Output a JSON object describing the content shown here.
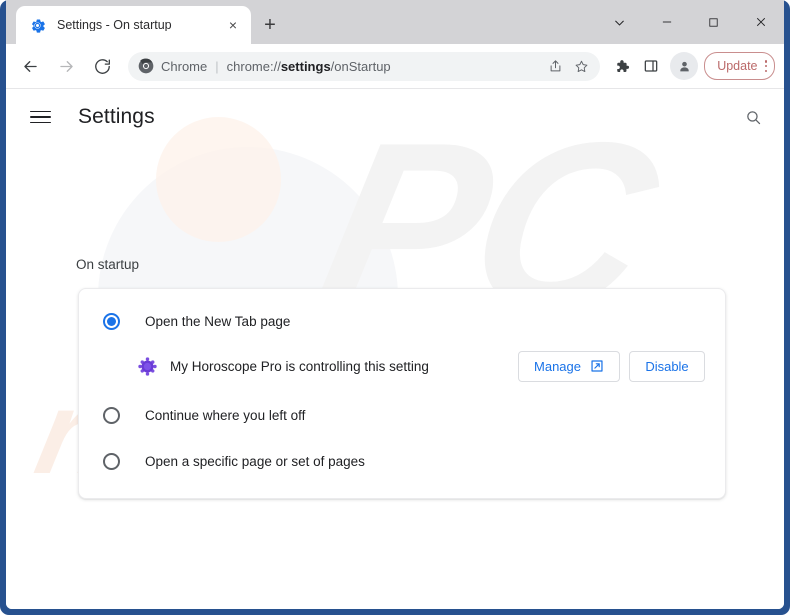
{
  "window": {
    "controls": [
      {
        "name": "tab-search-chevron",
        "glyph": "chevron-down-icon"
      },
      {
        "name": "minimize",
        "glyph": "minimize-icon"
      },
      {
        "name": "maximize",
        "glyph": "maximize-icon"
      },
      {
        "name": "close",
        "glyph": "close-icon"
      }
    ]
  },
  "tab": {
    "title": "Settings - On startup",
    "favicon": "settings-gear-icon",
    "close_label": "×",
    "new_tab_label": "+"
  },
  "toolbar": {
    "back_icon": "back-arrow-icon",
    "forward_icon": "forward-arrow-icon",
    "reload_icon": "reload-icon",
    "omnibox": {
      "site_chip": "Chrome",
      "separator": "|",
      "url_prefix": "chrome://",
      "url_bold": "settings",
      "url_suffix": "/onStartup",
      "share_icon": "share-icon",
      "bookmark_icon": "star-icon"
    },
    "extensions_icon": "puzzle-icon",
    "side_panel_icon": "side-panel-icon",
    "profile_icon": "profile-avatar-icon",
    "update_label": "Update",
    "menu_icon": "three-dot-menu-icon"
  },
  "settings": {
    "menu_icon": "hamburger-menu-icon",
    "title": "Settings",
    "search_icon": "search-icon",
    "section_label": "On startup",
    "options": [
      {
        "label": "Open the New Tab page",
        "checked": true
      },
      {
        "label": "Continue where you left off",
        "checked": false
      },
      {
        "label": "Open a specific page or set of pages",
        "checked": false
      }
    ],
    "extension_notice": {
      "icon": "extension-hexagon-icon",
      "text": "My Horoscope Pro is controlling this setting",
      "manage_label": "Manage",
      "manage_icon": "external-link-icon",
      "disable_label": "Disable"
    }
  },
  "watermark": {
    "big": "PC",
    "small": "risk.com"
  },
  "colors": {
    "window_border": "#27518f",
    "accent_blue": "#1a73e8",
    "update_red": "#bb6a6a",
    "extension_purple": "#6a3bd6"
  }
}
